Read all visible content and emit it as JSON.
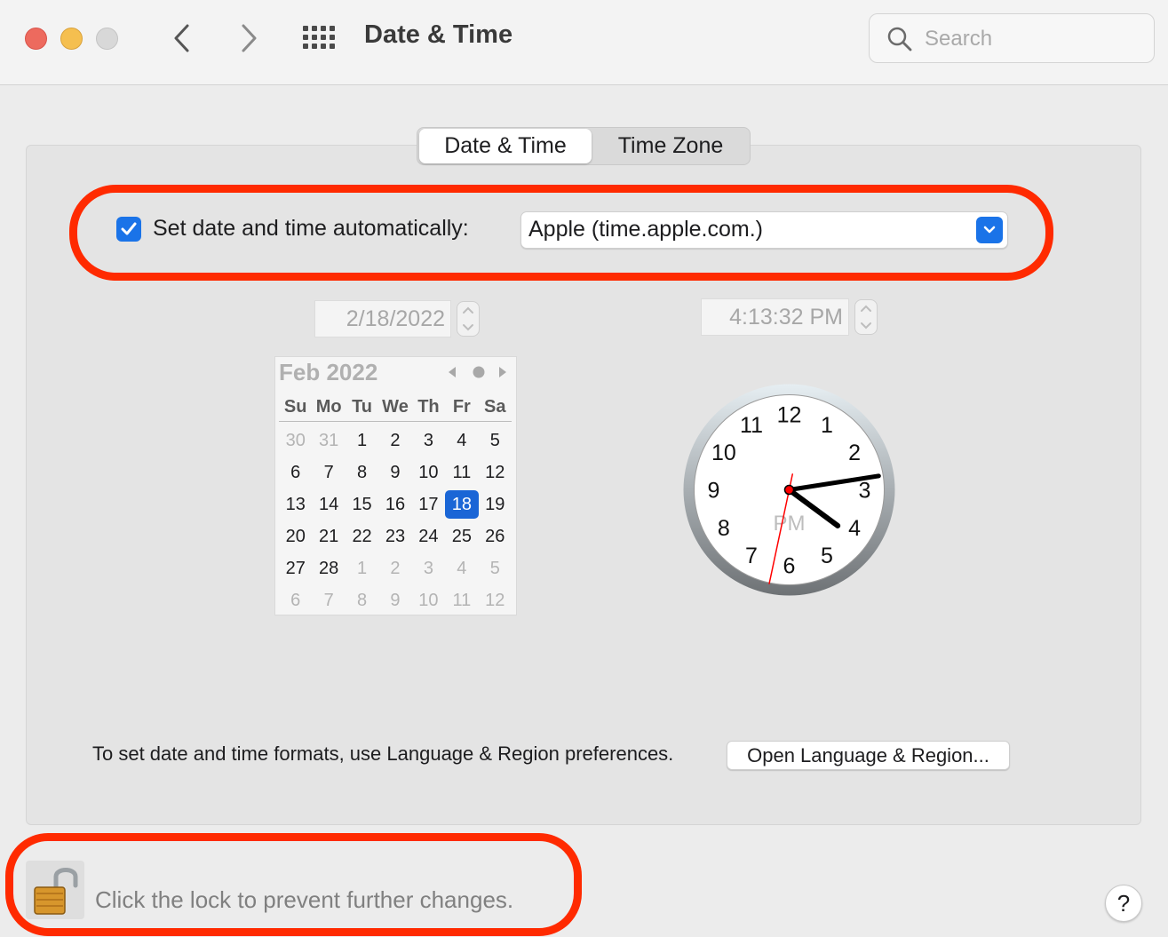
{
  "window": {
    "title": "Date & Time"
  },
  "toolbar": {
    "traffic_lights": [
      "close",
      "minimize",
      "zoom"
    ],
    "back_icon": "chevron-left-icon",
    "forward_icon": "chevron-right-icon",
    "show_all_icon": "grid-icon",
    "search_placeholder": "Search"
  },
  "tabs": [
    {
      "label": "Date & Time",
      "selected": true
    },
    {
      "label": "Time Zone",
      "selected": false
    }
  ],
  "auto": {
    "checked": true,
    "label": "Set date and time automatically:",
    "server": "Apple (time.apple.com.)"
  },
  "date_field": "2/18/2022",
  "time_field": "4:13:32 PM",
  "calendar": {
    "title": "Feb 2022",
    "weekdays": [
      "Su",
      "Mo",
      "Tu",
      "We",
      "Th",
      "Fr",
      "Sa"
    ],
    "days": [
      [
        "30",
        "31",
        "1",
        "2",
        "3",
        "4",
        "5"
      ],
      [
        "6",
        "7",
        "8",
        "9",
        "10",
        "11",
        "12"
      ],
      [
        "13",
        "14",
        "15",
        "16",
        "17",
        "18",
        "19"
      ],
      [
        "20",
        "21",
        "22",
        "23",
        "24",
        "25",
        "26"
      ],
      [
        "27",
        "28",
        "1",
        "2",
        "3",
        "4",
        "5"
      ],
      [
        "6",
        "7",
        "8",
        "9",
        "10",
        "11",
        "12"
      ]
    ],
    "muted_cells": [
      [
        0,
        0
      ],
      [
        0,
        1
      ],
      [
        4,
        2
      ],
      [
        4,
        3
      ],
      [
        4,
        4
      ],
      [
        4,
        5
      ],
      [
        4,
        6
      ],
      [
        5,
        0
      ],
      [
        5,
        1
      ],
      [
        5,
        2
      ],
      [
        5,
        3
      ],
      [
        5,
        4
      ],
      [
        5,
        5
      ],
      [
        5,
        6
      ]
    ],
    "selected_day": "18"
  },
  "clock": {
    "numbers": [
      "12",
      "1",
      "2",
      "3",
      "4",
      "5",
      "6",
      "7",
      "8",
      "9",
      "10",
      "11"
    ],
    "period": "PM",
    "hour": 4,
    "minute": 13,
    "second": 32
  },
  "formats": {
    "text": "To set date and time formats, use Language & Region preferences.",
    "button": "Open Language & Region..."
  },
  "lock": {
    "text": "Click the lock to prevent further changes.",
    "icon": "unlocked-padlock-icon"
  },
  "help": {
    "label": "?"
  },
  "colors": {
    "accent": "#1a73e8",
    "annotation": "#ff2a00",
    "second_hand": "#ff0000"
  }
}
